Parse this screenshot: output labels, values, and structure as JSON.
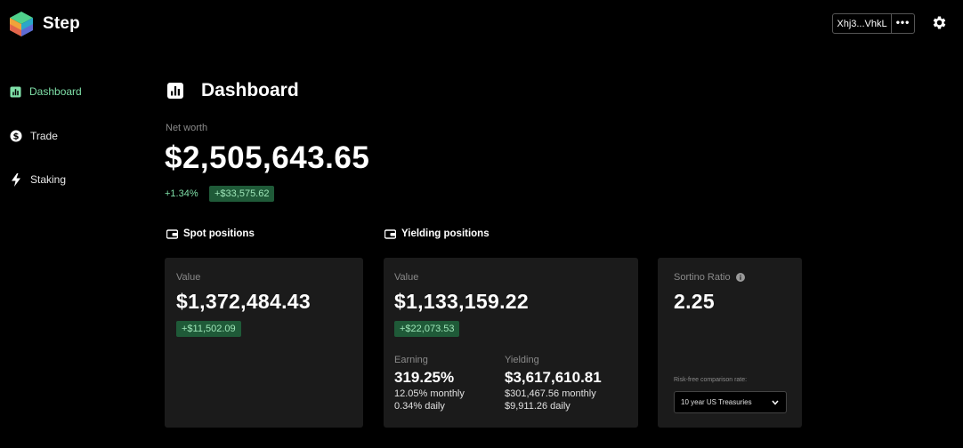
{
  "app": {
    "brand": "Step"
  },
  "header": {
    "wallet_address": "Xhj3...VhkL",
    "more_label": "•••"
  },
  "nav": {
    "items": [
      {
        "label": "Dashboard",
        "icon": "bar-chart-icon"
      },
      {
        "label": "Trade",
        "icon": "dollar-circle-icon"
      },
      {
        "label": "Staking",
        "icon": "lightning-icon"
      }
    ]
  },
  "page": {
    "title": "Dashboard"
  },
  "net_worth": {
    "label": "Net worth",
    "value": "$2,505,643.65",
    "change_pct": "+1.34%",
    "change_amount": "+$33,575.62"
  },
  "spot": {
    "section_label": "Spot positions",
    "value_label": "Value",
    "value": "$1,372,484.43",
    "change": "+$11,502.09"
  },
  "yielding": {
    "section_label": "Yielding positions",
    "value_label": "Value",
    "value": "$1,133,159.22",
    "change": "+$22,073.53",
    "earning": {
      "label": "Earning",
      "value": "319.25%",
      "monthly": "12.05% monthly",
      "daily": "0.34% daily"
    },
    "yielding": {
      "label": "Yielding",
      "value": "$3,617,610.81",
      "monthly": "$301,467.56 monthly",
      "daily": "$9,911.26 daily"
    }
  },
  "sortino": {
    "label": "Sortino Ratio",
    "value": "2.25",
    "rate_label": "Risk-free comparison rate:",
    "rate_selected": "10 year US Treasuries"
  },
  "colors": {
    "background": "#000000",
    "card": "#1b1b1b",
    "accent_green": "#7fe0a8",
    "badge_bg": "#1f5a38"
  }
}
